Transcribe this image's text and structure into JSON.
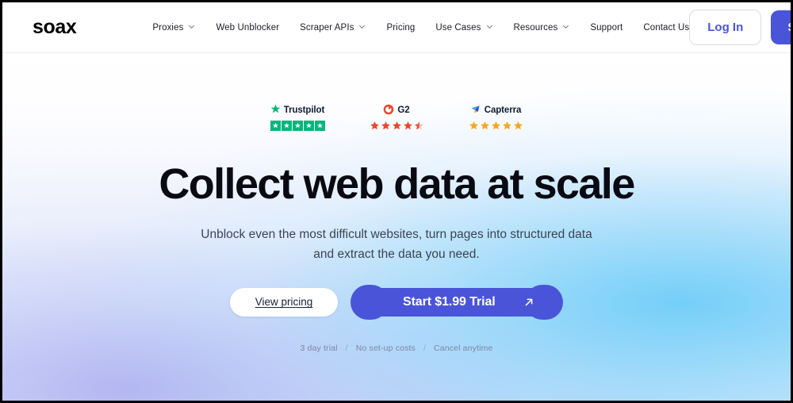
{
  "header": {
    "logo": "soax",
    "nav": [
      {
        "label": "Proxies",
        "has_chevron": true,
        "icon": "chevron-down-icon"
      },
      {
        "label": "Web Unblocker",
        "has_chevron": false
      },
      {
        "label": "Scraper APIs",
        "has_chevron": true,
        "icon": "chevron-down-icon"
      },
      {
        "label": "Pricing",
        "has_chevron": false
      },
      {
        "label": "Use Cases",
        "has_chevron": true,
        "icon": "chevron-down-icon"
      },
      {
        "label": "Resources",
        "has_chevron": true,
        "icon": "chevron-down-icon"
      },
      {
        "label": "Support",
        "has_chevron": false
      },
      {
        "label": "Contact Us",
        "has_chevron": false
      }
    ],
    "login_label": "Log In",
    "signup_label": "Sign Up",
    "login_text_color": "#4a54d8",
    "signup_bg_color": "#4a54d8"
  },
  "hero": {
    "badges": [
      {
        "name": "Trustpilot",
        "icon": "trustpilot-star-icon",
        "style": "squares",
        "rating": 5,
        "star_color": "#00b67a",
        "text_color": "#0f1b33"
      },
      {
        "name": "G2",
        "icon": "g2-logo-icon",
        "style": "stars",
        "rating": 4.5,
        "star_color": "#e8482c",
        "text_color": "#0f1b33"
      },
      {
        "name": "Capterra",
        "icon": "capterra-logo-icon",
        "style": "stars",
        "rating": 5,
        "star_color": "#f5a623",
        "text_color": "#0f1b33"
      }
    ],
    "headline": "Collect web data at scale",
    "subhead_line1": "Unblock even the most difficult websites, turn pages into structured data",
    "subhead_line2": "and extract the data you need.",
    "view_pricing_label": "View pricing",
    "trial_label": "Start $1.99 Trial",
    "trial_arrow_icon": "arrow-up-right-icon",
    "fineprint": [
      "3 day trial",
      "No set-up costs",
      "Cancel anytime"
    ],
    "fineprint_separator": "/"
  }
}
